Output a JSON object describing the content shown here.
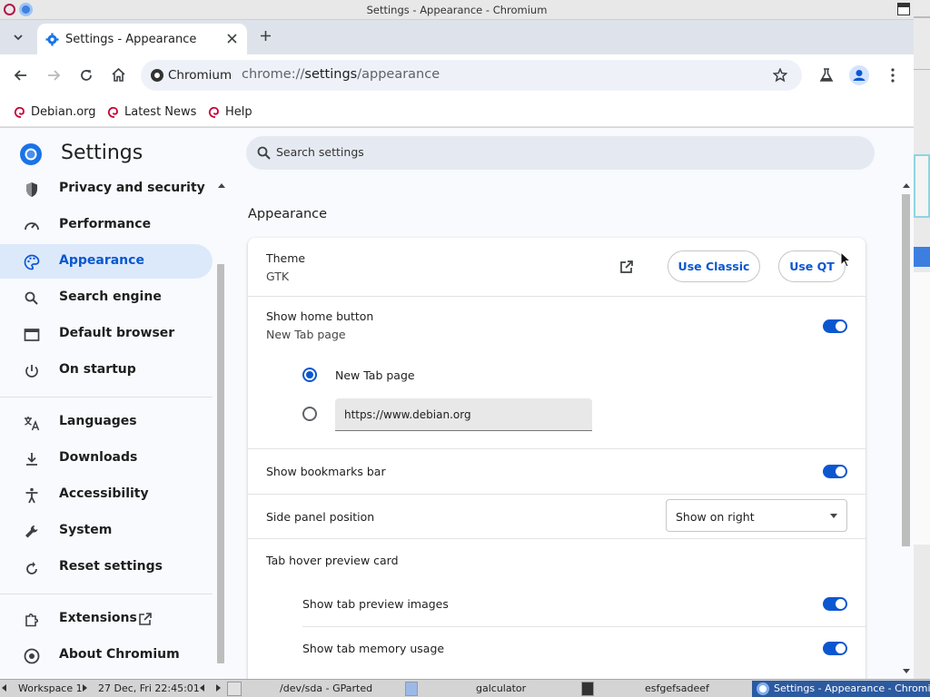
{
  "window": {
    "title": "Settings - Appearance - Chromium"
  },
  "tab": {
    "title": "Settings - Appearance"
  },
  "omnibox": {
    "chip": "Chromium",
    "url_prefix": "chrome://",
    "url_host": "settings",
    "url_path": "/appearance"
  },
  "bookmarks": [
    {
      "label": "Debian.org"
    },
    {
      "label": "Latest News"
    },
    {
      "label": "Help"
    }
  ],
  "settings": {
    "title": "Settings",
    "search_placeholder": "Search settings",
    "nav": [
      {
        "label": "Privacy and security",
        "icon": "shield-icon"
      },
      {
        "label": "Performance",
        "icon": "speedometer-icon"
      },
      {
        "label": "Appearance",
        "icon": "palette-icon",
        "selected": true
      },
      {
        "label": "Search engine",
        "icon": "search-icon"
      },
      {
        "label": "Default browser",
        "icon": "browser-window-icon"
      },
      {
        "label": "On startup",
        "icon": "power-icon"
      },
      {
        "label": "Languages",
        "icon": "translate-icon"
      },
      {
        "label": "Downloads",
        "icon": "download-icon"
      },
      {
        "label": "Accessibility",
        "icon": "accessibility-icon"
      },
      {
        "label": "System",
        "icon": "wrench-icon"
      },
      {
        "label": "Reset settings",
        "icon": "reset-icon"
      },
      {
        "label": "Extensions",
        "icon": "puzzle-icon"
      },
      {
        "label": "About Chromium",
        "icon": "chromium-icon"
      }
    ],
    "section_title": "Appearance",
    "theme": {
      "label": "Theme",
      "value": "GTK",
      "classic_button": "Use Classic",
      "qt_button": "Use QT"
    },
    "home_button": {
      "label": "Show home button",
      "sub": "New Tab page",
      "enabled": true,
      "option_newtab": "New Tab page",
      "custom_url": "https://www.debian.org",
      "selected": "New Tab page"
    },
    "bookmarks_bar": {
      "label": "Show bookmarks bar",
      "enabled": true
    },
    "side_panel": {
      "label": "Side panel position",
      "value": "Show on right"
    },
    "tab_hover": {
      "label": "Tab hover preview card",
      "preview_images": {
        "label": "Show tab preview images",
        "enabled": true
      },
      "memory_usage": {
        "label": "Show tab memory usage",
        "enabled": true
      }
    }
  },
  "taskbar": {
    "workspace": "Workspace 1",
    "clock": "27 Dec, Fri 22:45:01",
    "tasks": [
      "/dev/sda - GParted",
      "galculator",
      "esfgefsadeef",
      "Settings - Appearance - Chromi"
    ]
  },
  "colors": {
    "accent": "#0b57d0",
    "selected_nav_bg": "#dce9fb",
    "page_bg": "#f8fafd"
  }
}
